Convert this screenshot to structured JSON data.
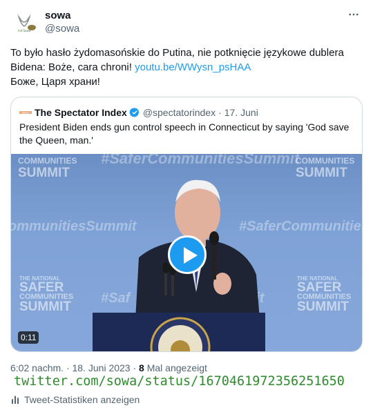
{
  "author": {
    "name": "sowa",
    "handle": "@sowa"
  },
  "tweet": {
    "line1": "To było hasło żydomasońskie do Putina, nie potknięcie językowe dublera",
    "line2_text": "Bidena: Boże, cara chroni! ",
    "line2_link": "youtu.be/WWysn_psHAA",
    "line3": "Боже, Царя храни!"
  },
  "quote": {
    "name": "The Spectator Index",
    "handle": "@spectatorindex",
    "separator": "·",
    "date": "17. Juni",
    "text_line1": "President Biden ends gun control speech in Connecticut by saying 'God save",
    "text_line2": "the Queen, man.'",
    "video": {
      "duration": "0:11",
      "watermark_top": "#SaferCommunitiesSummit",
      "watermark_mid_left": "ommunitiesSummit",
      "watermark_mid_right": "#SaferCommunities",
      "watermark_low_left": "#Saf",
      "watermark_low_right": "nit",
      "logo_small": "THE NATIONAL",
      "logo_line1": "SAFER",
      "logo_line2": "COMMUNITIES",
      "logo_line3": "SUMMIT",
      "logo_top1": "COMMUNITIES",
      "logo_top2": "SUMMIT"
    }
  },
  "meta": {
    "time": "6:02 nachm.",
    "dot1": "·",
    "date": "18. Juni 2023",
    "dot2": "·",
    "views_count": "8",
    "views_label": "Mal angezeigt"
  },
  "overlay_url": "twitter.com/sowa/status/1670461972356251650",
  "stats_link": "Tweet-Statistiken anzeigen",
  "icons": {
    "more": "more-horizontal-icon",
    "verified": "verified-badge-icon",
    "play": "play-icon",
    "stats": "bar-chart-icon"
  },
  "colors": {
    "link": "#1d9bf0",
    "muted": "#536471",
    "overlay_url": "#2e8b2e"
  }
}
